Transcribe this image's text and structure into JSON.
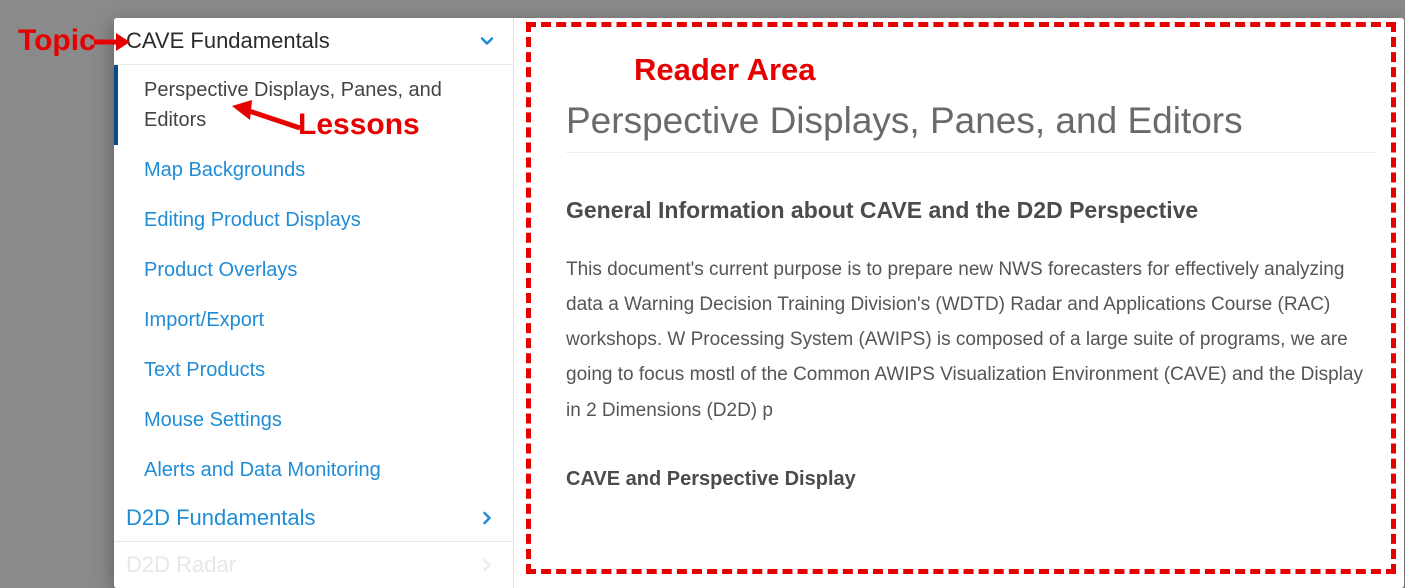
{
  "sidebar": {
    "topics": [
      {
        "label": "CAVE Fundamentals",
        "expanded": true
      },
      {
        "label": "D2D Fundamentals",
        "expanded": false
      },
      {
        "label": "D2D Radar",
        "expanded": false
      }
    ],
    "lessons": [
      "Perspective Displays, Panes, and Editors",
      "Map Backgrounds",
      "Editing Product Displays",
      "Product Overlays",
      "Import/Export",
      "Text Products",
      "Mouse Settings",
      "Alerts and Data Monitoring"
    ]
  },
  "reader": {
    "title": "Perspective Displays, Panes, and Editors",
    "section1_heading": "General Information about CAVE and the D2D Perspective",
    "section1_body": "This document's current purpose is to prepare new NWS forecasters for effectively analyzing data a Warning Decision Training Division's (WDTD) Radar and Applications Course (RAC) workshops. W Processing System (AWIPS) is composed of a large suite of programs, we are going to focus mostl of the Common AWIPS Visualization Environment (CAVE) and the Display in 2 Dimensions (D2D) p",
    "section2_heading": "CAVE and Perspective Display"
  },
  "annotations": {
    "topic_label": "Topic",
    "lessons_label": "Lessons",
    "reader_area_label": "Reader Area"
  }
}
